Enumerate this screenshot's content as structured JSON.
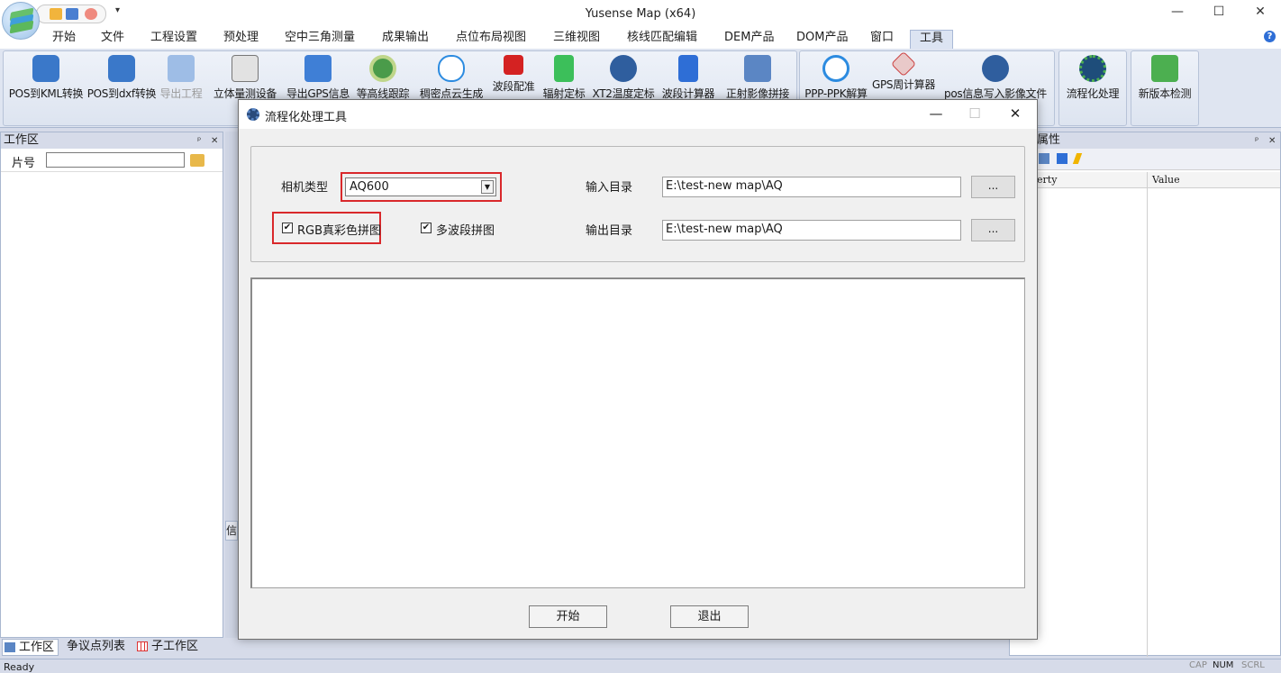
{
  "window": {
    "title": "Yusense Map (x64)",
    "minimize": "—",
    "maximize": "☐",
    "close": "✕"
  },
  "quick_access": {
    "more": "▾"
  },
  "ribbon": {
    "tabs": [
      {
        "label": "开始"
      },
      {
        "label": "文件"
      },
      {
        "label": "工程设置"
      },
      {
        "label": "预处理"
      },
      {
        "label": "空中三角测量"
      },
      {
        "label": "成果输出"
      },
      {
        "label": "点位布局视图"
      },
      {
        "label": "三维视图"
      },
      {
        "label": "核线匹配编辑"
      },
      {
        "label": "DEM产品"
      },
      {
        "label": "DOM产品"
      },
      {
        "label": "窗口"
      },
      {
        "label": "工具"
      }
    ],
    "active_tab": "工具",
    "help": "?",
    "buttons": [
      {
        "label": "POS到KML转换",
        "icon": "kml-icon"
      },
      {
        "label": "POS到dxf转换",
        "icon": "dxf-icon"
      },
      {
        "label": "导出工程",
        "icon": "export-project-icon",
        "disabled": true
      },
      {
        "label": "立体量测设备",
        "icon": "stereo-device-icon"
      },
      {
        "label": "导出GPS信息",
        "icon": "gps-export-icon"
      },
      {
        "label": "等高线跟踪",
        "icon": "contour-icon"
      },
      {
        "label": "稠密点云生成",
        "icon": "cloud-icon"
      },
      {
        "label": "波段配准",
        "icon": "band-register-icon"
      },
      {
        "label": "辐射定标",
        "icon": "radiometric-icon"
      },
      {
        "label": "XT2温度定标",
        "icon": "temperature-icon"
      },
      {
        "label": "波段计算器",
        "icon": "calculator-icon"
      },
      {
        "label": "正射影像拼接",
        "icon": "ortho-mosaic-icon"
      },
      {
        "label": "PPP-PPK解算",
        "icon": "ppk-icon"
      },
      {
        "label": "GPS周计算器",
        "icon": "satellite-icon"
      },
      {
        "label": "pos信息写入影像文件",
        "icon": "pos-write-icon"
      },
      {
        "label": "流程化处理",
        "icon": "workflow-icon"
      },
      {
        "label": "新版本检测",
        "icon": "update-icon"
      }
    ]
  },
  "workspace": {
    "title": "工作区",
    "pin": "ᵖ",
    "close": "✕",
    "slice_label": "片号",
    "slice_value": "",
    "tabs": [
      {
        "label": "工作区"
      },
      {
        "label": "争议点列表"
      },
      {
        "label": "子工作区"
      }
    ]
  },
  "middle_tab": {
    "label": "信"
  },
  "properties": {
    "title": "属性",
    "col1": "erty",
    "col2": "Value"
  },
  "status": {
    "text": "Ready",
    "keys": [
      {
        "label": "CAP",
        "on": false
      },
      {
        "label": "NUM",
        "on": true
      },
      {
        "label": "SCRL",
        "on": false
      }
    ]
  },
  "dialog": {
    "title": "流程化处理工具",
    "camera_label": "相机类型",
    "camera_value": "AQ600",
    "rgb_label": "RGB真彩色拼图",
    "rgb_checked": "✔",
    "multiband_label": "多波段拼图",
    "multiband_checked": "✔",
    "input_label": "输入目录",
    "input_value": "E:\\test-new map\\AQ",
    "output_label": "输出目录",
    "output_value": "E:\\test-new map\\AQ",
    "browse": "...",
    "start": "开始",
    "exit": "退出"
  },
  "colors": {
    "accent": "#2e6ed6",
    "highlight_frame": "#d9282b"
  }
}
